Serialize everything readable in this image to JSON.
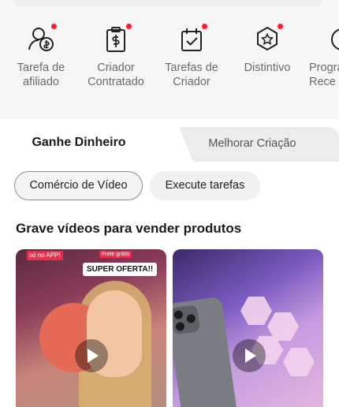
{
  "quick_actions": [
    {
      "label_line1": "Tarefa de",
      "label_line2": "afiliado",
      "icon": "affiliate-people-icon",
      "has_dot": true
    },
    {
      "label_line1": "Criador",
      "label_line2": "Contratado",
      "icon": "dollar-clipboard-icon",
      "has_dot": true
    },
    {
      "label_line1": "Tarefas de",
      "label_line2": "Criador",
      "icon": "calendar-check-icon",
      "has_dot": true
    },
    {
      "label_line1": "Distintivo",
      "label_line2": "",
      "icon": "badge-icon",
      "has_dot": true
    },
    {
      "label_line1": "Progra",
      "label_line2": "Rece",
      "icon": "circle-icon",
      "has_dot": false
    }
  ],
  "tabs": {
    "active": "Ganhe Dinheiro",
    "inactive": "Melhorar Criação"
  },
  "chips": {
    "active": "Comércio de Vídeo",
    "inactive": "Execute tarefas"
  },
  "section": {
    "title": "Grave vídeos para vender produtos"
  },
  "videos": [
    {
      "badge": "SUPER OFERTA!!",
      "promo_1": "só no APP!",
      "promo_2": "Frete grátis"
    },
    {}
  ],
  "colors": {
    "dot": "#ff1a2e",
    "tab_inactive_bg": "#ececec",
    "chip_border": "#8d8d8d"
  }
}
